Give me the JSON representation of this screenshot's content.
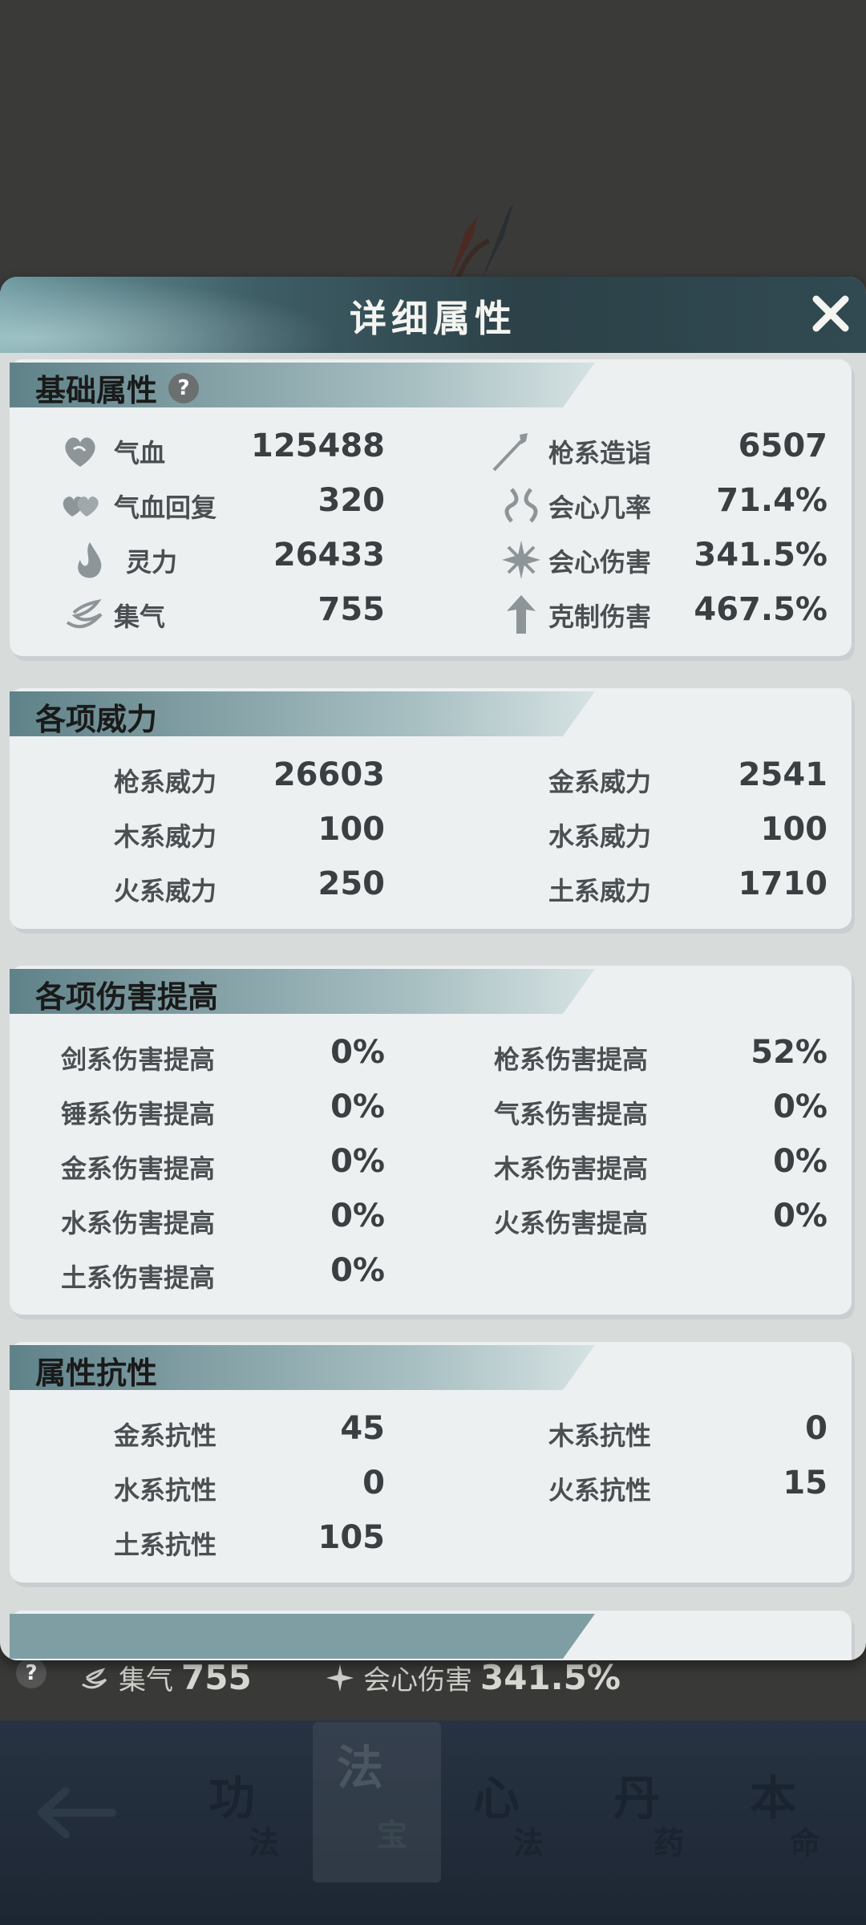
{
  "modal": {
    "title": "详细属性",
    "sections": [
      {
        "title": "基础属性",
        "help": "?",
        "rows": [
          {
            "left": {
              "icon": "heart-icon",
              "label": "气血",
              "value": "125488"
            },
            "right": {
              "icon": "spear-icon",
              "label": "枪系造诣",
              "value": "6507"
            }
          },
          {
            "left": {
              "icon": "twin-heart-icon",
              "label": "气血回复",
              "value": "320"
            },
            "right": {
              "icon": "knot-icon",
              "label": "会心几率",
              "value": "71.4%"
            }
          },
          {
            "left": {
              "icon": "flame-icon",
              "label": "灵力",
              "value": "26433"
            },
            "right": {
              "icon": "burst-icon",
              "label": "会心伤害",
              "value": "341.5%"
            }
          },
          {
            "left": {
              "icon": "swirl-icon",
              "label": "集气",
              "value": "755"
            },
            "right": {
              "icon": "up-arrow-icon",
              "label": "克制伤害",
              "value": "467.5%"
            }
          }
        ]
      },
      {
        "title": "各项威力",
        "rows": [
          {
            "left": {
              "label": "枪系威力",
              "value": "26603"
            },
            "right": {
              "label": "金系威力",
              "value": "2541"
            }
          },
          {
            "left": {
              "label": "木系威力",
              "value": "100"
            },
            "right": {
              "label": "水系威力",
              "value": "100"
            }
          },
          {
            "left": {
              "label": "火系威力",
              "value": "250"
            },
            "right": {
              "label": "土系威力",
              "value": "1710"
            }
          }
        ]
      },
      {
        "title": "各项伤害提高",
        "rows": [
          {
            "left": {
              "label": "剑系伤害提高",
              "value": "0%"
            },
            "right": {
              "label": "枪系伤害提高",
              "value": "52%"
            }
          },
          {
            "left": {
              "label": "锤系伤害提高",
              "value": "0%"
            },
            "right": {
              "label": "气系伤害提高",
              "value": "0%"
            }
          },
          {
            "left": {
              "label": "金系伤害提高",
              "value": "0%"
            },
            "right": {
              "label": "木系伤害提高",
              "value": "0%"
            }
          },
          {
            "left": {
              "label": "水系伤害提高",
              "value": "0%"
            },
            "right": {
              "label": "火系伤害提高",
              "value": "0%"
            }
          },
          {
            "left": {
              "label": "土系伤害提高",
              "value": "0%"
            }
          }
        ]
      },
      {
        "title": "属性抗性",
        "rows": [
          {
            "left": {
              "label": "金系抗性",
              "value": "45"
            },
            "right": {
              "label": "木系抗性",
              "value": "0"
            }
          },
          {
            "left": {
              "label": "水系抗性",
              "value": "0"
            },
            "right": {
              "label": "火系抗性",
              "value": "15"
            }
          },
          {
            "left": {
              "label": "土系抗性",
              "value": "105"
            }
          }
        ]
      }
    ]
  },
  "underlay": {
    "help": "?",
    "stat1_label": "集气",
    "stat1_value": "755",
    "stat2_label": "会心伤害",
    "stat2_value": "341.5%"
  },
  "bottom_nav": {
    "tabs": [
      {
        "big": "功",
        "small": "法"
      },
      {
        "big": "法",
        "small": "宝",
        "active": true
      },
      {
        "big": "心",
        "small": "法"
      },
      {
        "big": "丹",
        "small": "药"
      },
      {
        "big": "本",
        "small": "命"
      }
    ]
  },
  "colors": {
    "header_dark": "#2c4148",
    "header_light": "#6f9aa1",
    "panel": "#edf0f1",
    "nav_bg": "#1d2633"
  }
}
